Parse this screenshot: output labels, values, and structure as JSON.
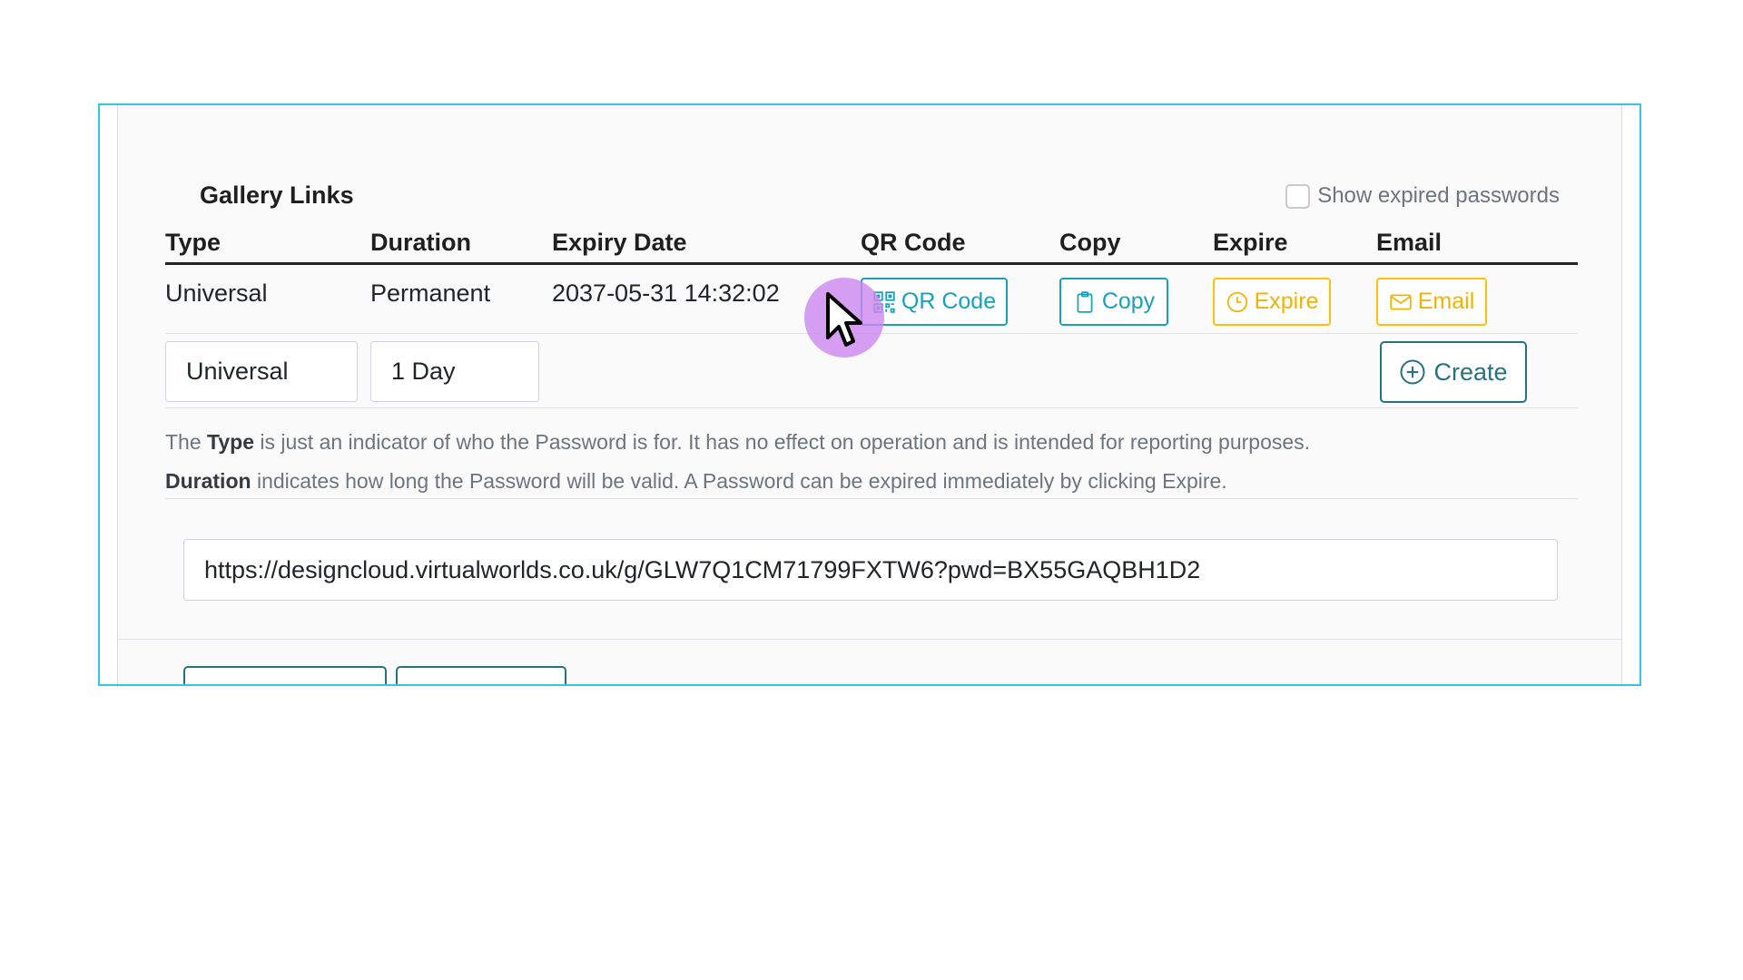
{
  "panel": {
    "title": "Gallery Links",
    "show_expired_label": "Show expired passwords",
    "show_expired_checked": false
  },
  "table": {
    "headers": [
      "Type",
      "Duration",
      "Expiry Date",
      "QR Code",
      "Copy",
      "Expire",
      "Email"
    ],
    "rows": [
      {
        "type": "Universal",
        "duration": "Permanent",
        "expiry": "2037-05-31 14:32:02",
        "qr_label": "QR Code",
        "copy_label": "Copy",
        "expire_label": "Expire",
        "email_label": "Email"
      }
    ]
  },
  "create_form": {
    "type_value": "Universal",
    "duration_value": "1 Day",
    "create_label": "Create"
  },
  "help": {
    "line1_prefix": "The ",
    "line1_bold": "Type",
    "line1_rest": " is just an indicator of who the Password is for. It has no effect on operation and is intended for reporting purposes.",
    "line2_bold": "Duration",
    "line2_rest": " indicates how long the Password will be valid. A Password can be expired immediately by clicking Expire."
  },
  "link_url": "https://designcloud.virtualworlds.co.uk/g/GLW7Q1CM71799FXTW6?pwd=BX55GAQBH1D2",
  "icons": {
    "qr": "qr-code-icon",
    "copy": "clipboard-icon",
    "expire": "clock-icon",
    "email": "envelope-icon",
    "create": "plus-circle-icon",
    "cursor": "mouse-pointer-icon"
  },
  "colors": {
    "frame_border": "#32c5ee",
    "info": "#17a2b8",
    "warning": "#ffc107",
    "create": "#25737f",
    "cursor_highlight": "#cd87f0"
  }
}
